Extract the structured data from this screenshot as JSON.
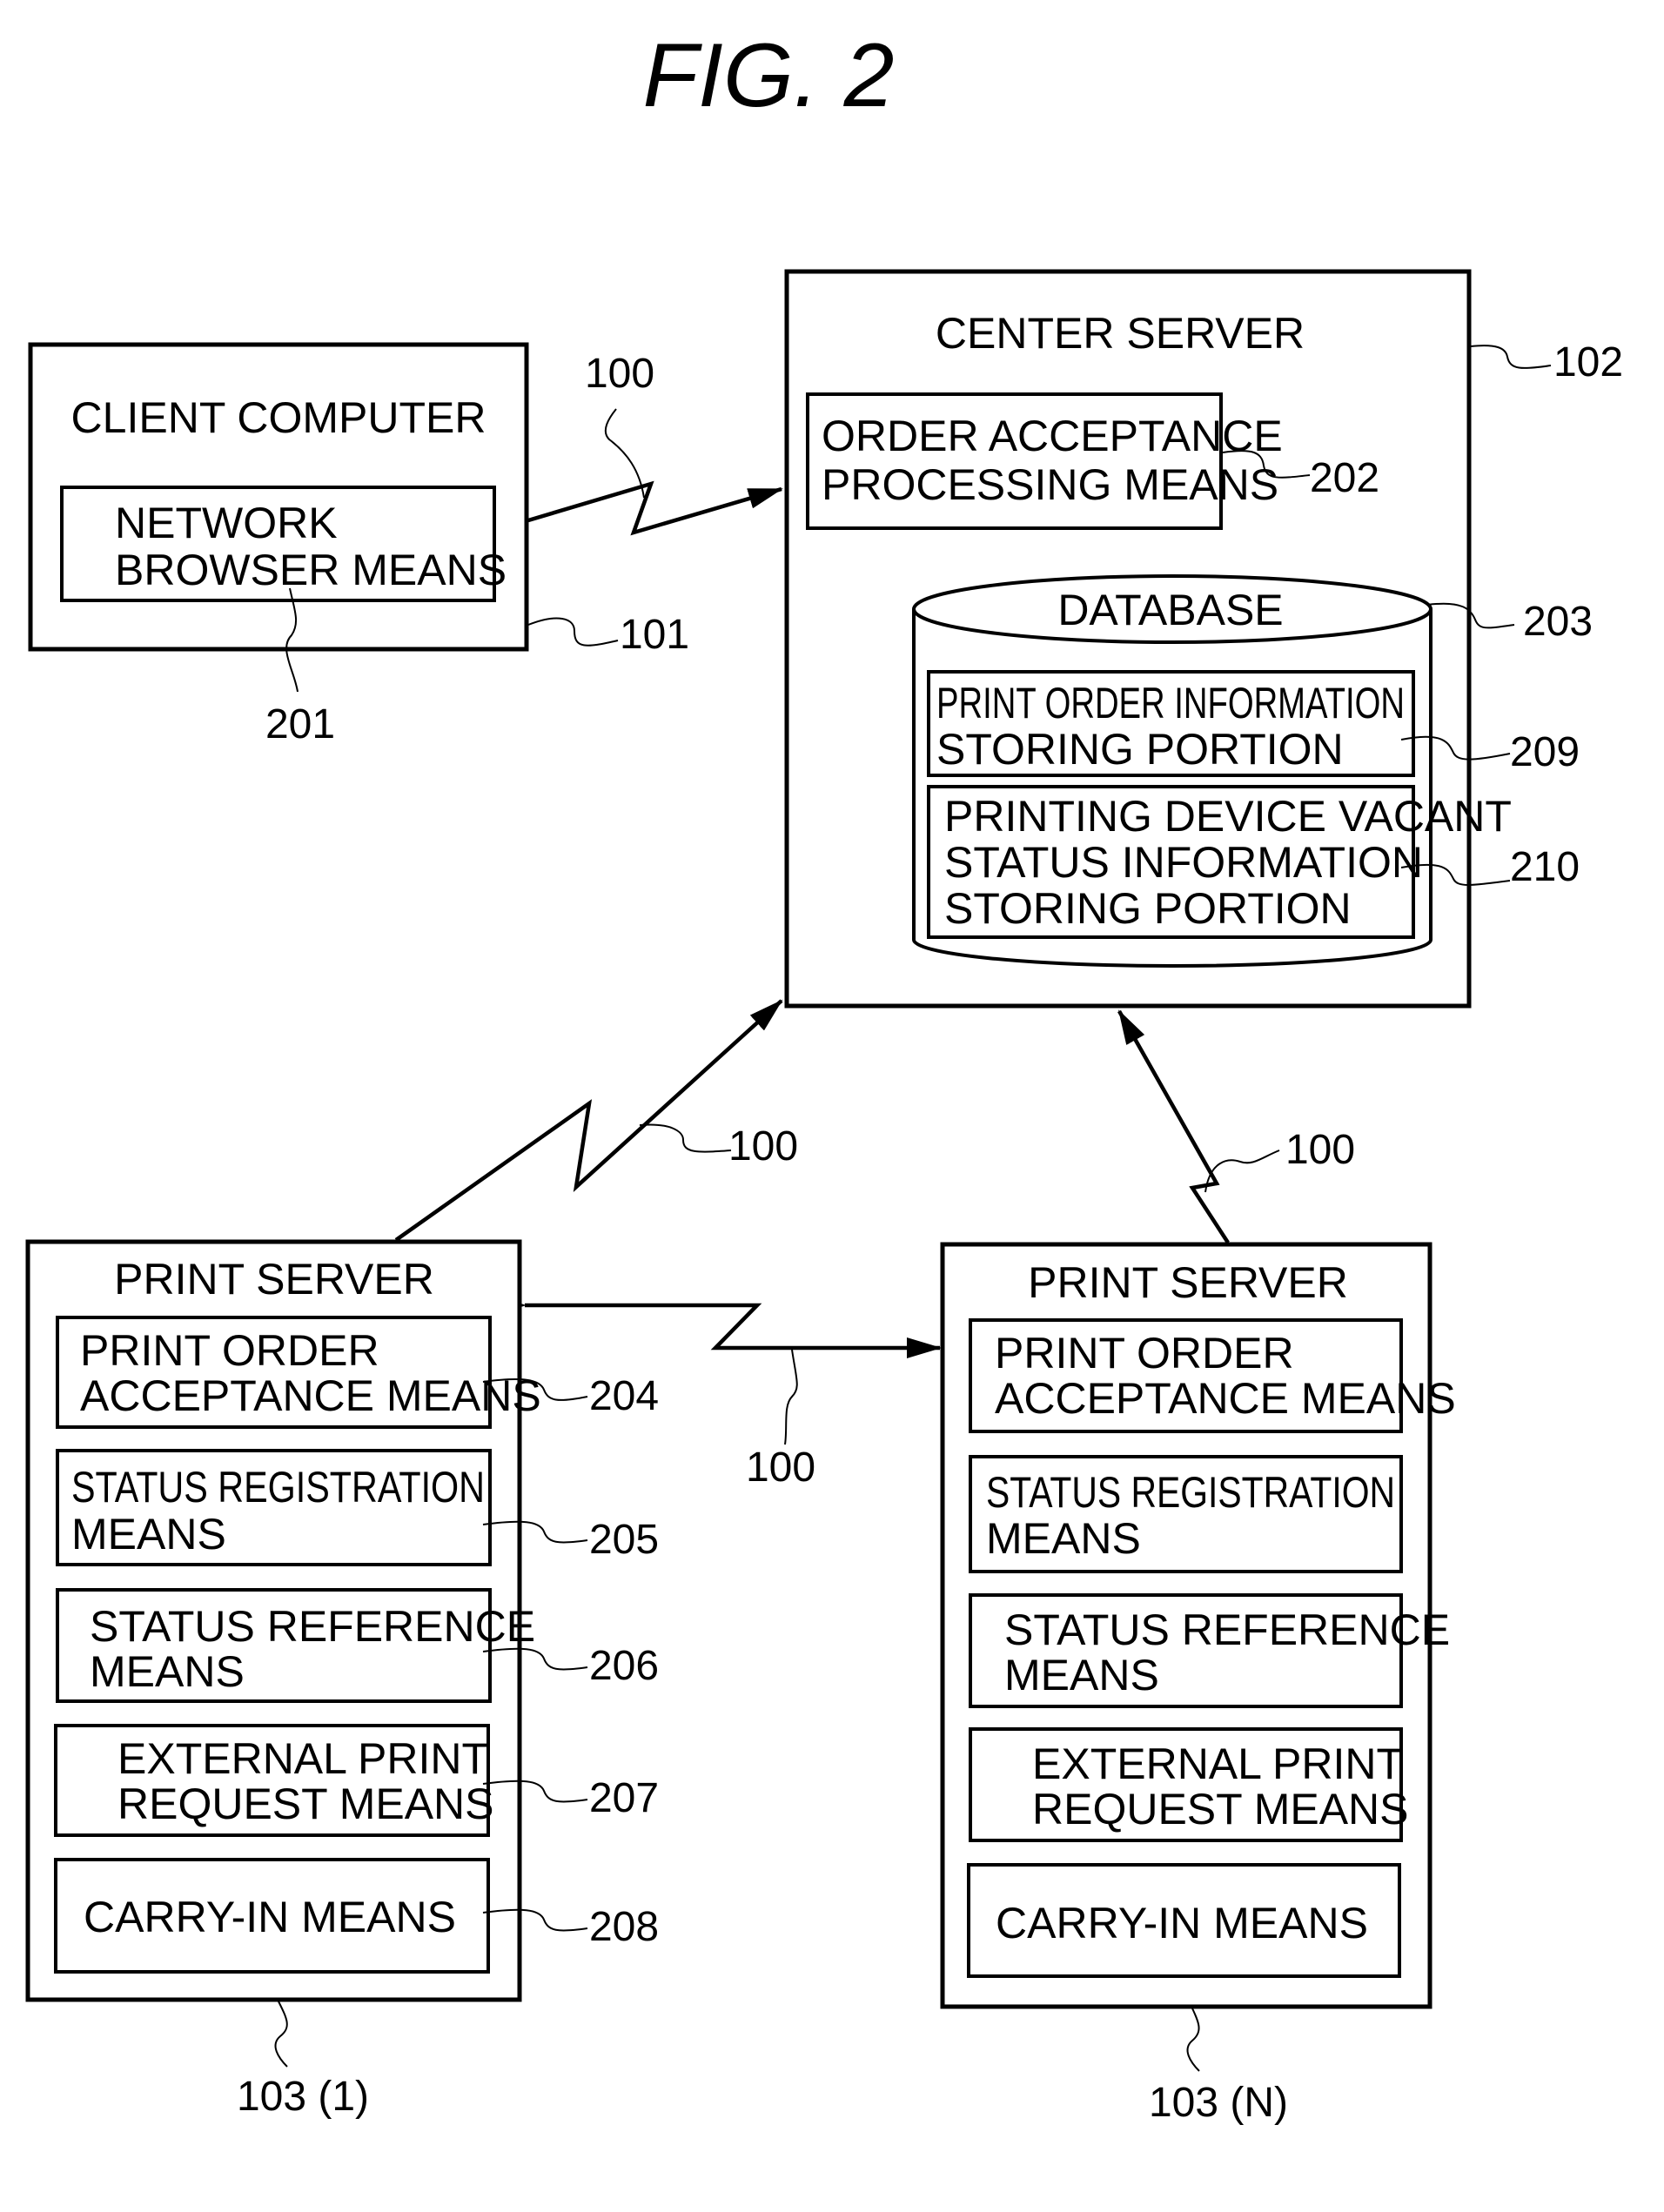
{
  "figure": {
    "title": "FIG. 2"
  },
  "client_computer": {
    "title": "CLIENT COMPUTER",
    "ref": "101",
    "modules": [
      {
        "lines": [
          "NETWORK",
          "BROWSER MEANS"
        ],
        "ref": "201"
      }
    ]
  },
  "center_server": {
    "title": "CENTER SERVER",
    "ref": "102",
    "modules": [
      {
        "lines": [
          "ORDER ACCEPTANCE",
          "PROCESSING MEANS"
        ],
        "ref": "202"
      }
    ],
    "database": {
      "title": "DATABASE",
      "ref": "203",
      "portions": [
        {
          "lines": [
            "PRINT ORDER INFORMATION",
            "STORING PORTION"
          ],
          "ref": "209"
        },
        {
          "lines": [
            "PRINTING DEVICE VACANT",
            "STATUS INFORMATION",
            "STORING PORTION"
          ],
          "ref": "210"
        }
      ]
    }
  },
  "print_servers": [
    {
      "title": "PRINT SERVER",
      "ref": "103 (1)",
      "modules": [
        {
          "lines": [
            "PRINT ORDER",
            "ACCEPTANCE MEANS"
          ],
          "ref": "204"
        },
        {
          "lines": [
            "STATUS REGISTRATION",
            "MEANS"
          ],
          "ref": "205"
        },
        {
          "lines": [
            "STATUS REFERENCE",
            "MEANS"
          ],
          "ref": "206"
        },
        {
          "lines": [
            "EXTERNAL PRINT",
            "REQUEST MEANS"
          ],
          "ref": "207"
        },
        {
          "lines": [
            "CARRY-IN MEANS"
          ],
          "ref": "208"
        }
      ]
    },
    {
      "title": "PRINT SERVER",
      "ref": "103 (N)",
      "modules": [
        {
          "lines": [
            "PRINT ORDER",
            "ACCEPTANCE MEANS"
          ]
        },
        {
          "lines": [
            "STATUS REGISTRATION",
            "MEANS"
          ]
        },
        {
          "lines": [
            "STATUS REFERENCE",
            "MEANS"
          ]
        },
        {
          "lines": [
            "EXTERNAL PRINT",
            "REQUEST MEANS"
          ]
        },
        {
          "lines": [
            "CARRY-IN MEANS"
          ]
        }
      ]
    }
  ],
  "network": {
    "ref_labels": [
      "100",
      "100",
      "100",
      "100"
    ]
  }
}
